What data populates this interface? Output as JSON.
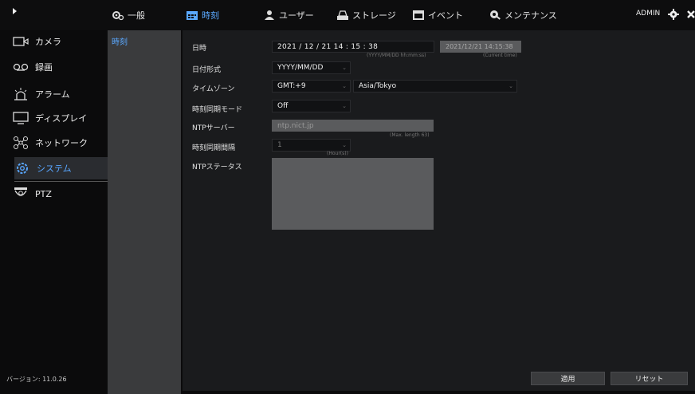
{
  "topbar": {
    "tabs": [
      {
        "label": "一般",
        "icon": "gear-icon"
      },
      {
        "label": "時刻",
        "icon": "calendar-icon",
        "active": true
      },
      {
        "label": "ユーザー",
        "icon": "user-icon"
      },
      {
        "label": "ストレージ",
        "icon": "storage-icon"
      },
      {
        "label": "イベント",
        "icon": "event-icon"
      },
      {
        "label": "メンテナンス",
        "icon": "maintenance-icon"
      }
    ],
    "user": "ADMIN"
  },
  "sidebar": {
    "items": [
      {
        "label": "カメラ",
        "icon": "camera-icon"
      },
      {
        "label": "録画",
        "icon": "record-icon"
      },
      {
        "label": "アラーム",
        "icon": "alarm-icon"
      },
      {
        "label": "ディスプレイ",
        "icon": "monitor-icon"
      },
      {
        "label": "ネットワーク",
        "icon": "network-icon"
      },
      {
        "label": "システム",
        "icon": "system-gear-icon",
        "active": true
      },
      {
        "label": "PTZ",
        "icon": "ptz-icon"
      }
    ],
    "version": "バージョン: 11.0.26"
  },
  "subnav": {
    "active": "時刻"
  },
  "form": {
    "datetime": {
      "label": "日時",
      "value": "2021  /  12  /  21     14  :  15  :  38",
      "format_hint": "(YYYY/MM/DD hh:mm:ss)",
      "current": "2021/12/21 14:15:38",
      "current_hint": "(Current time)"
    },
    "date_format": {
      "label": "日付形式",
      "value": "YYYY/MM/DD"
    },
    "timezone": {
      "label": "タイムゾーン",
      "offset": "GMT:+9",
      "zone": "Asia/Tokyo"
    },
    "sync_mode": {
      "label": "時刻同期モード",
      "value": "Off"
    },
    "ntp_server": {
      "label": "NTPサーバー",
      "value": "ntp.nict.jp",
      "hint": "(Max. length 63)"
    },
    "sync_interval": {
      "label": "時刻同期間隔",
      "value": "1",
      "hint": "(Hour(s))"
    },
    "ntp_status": {
      "label": "NTPステータス"
    }
  },
  "buttons": {
    "apply": "適用",
    "reset": "リセット"
  },
  "colors": {
    "accent": "#5aa8ff",
    "panel": "#1a1b1d",
    "subcol": "#3a3b3d"
  }
}
